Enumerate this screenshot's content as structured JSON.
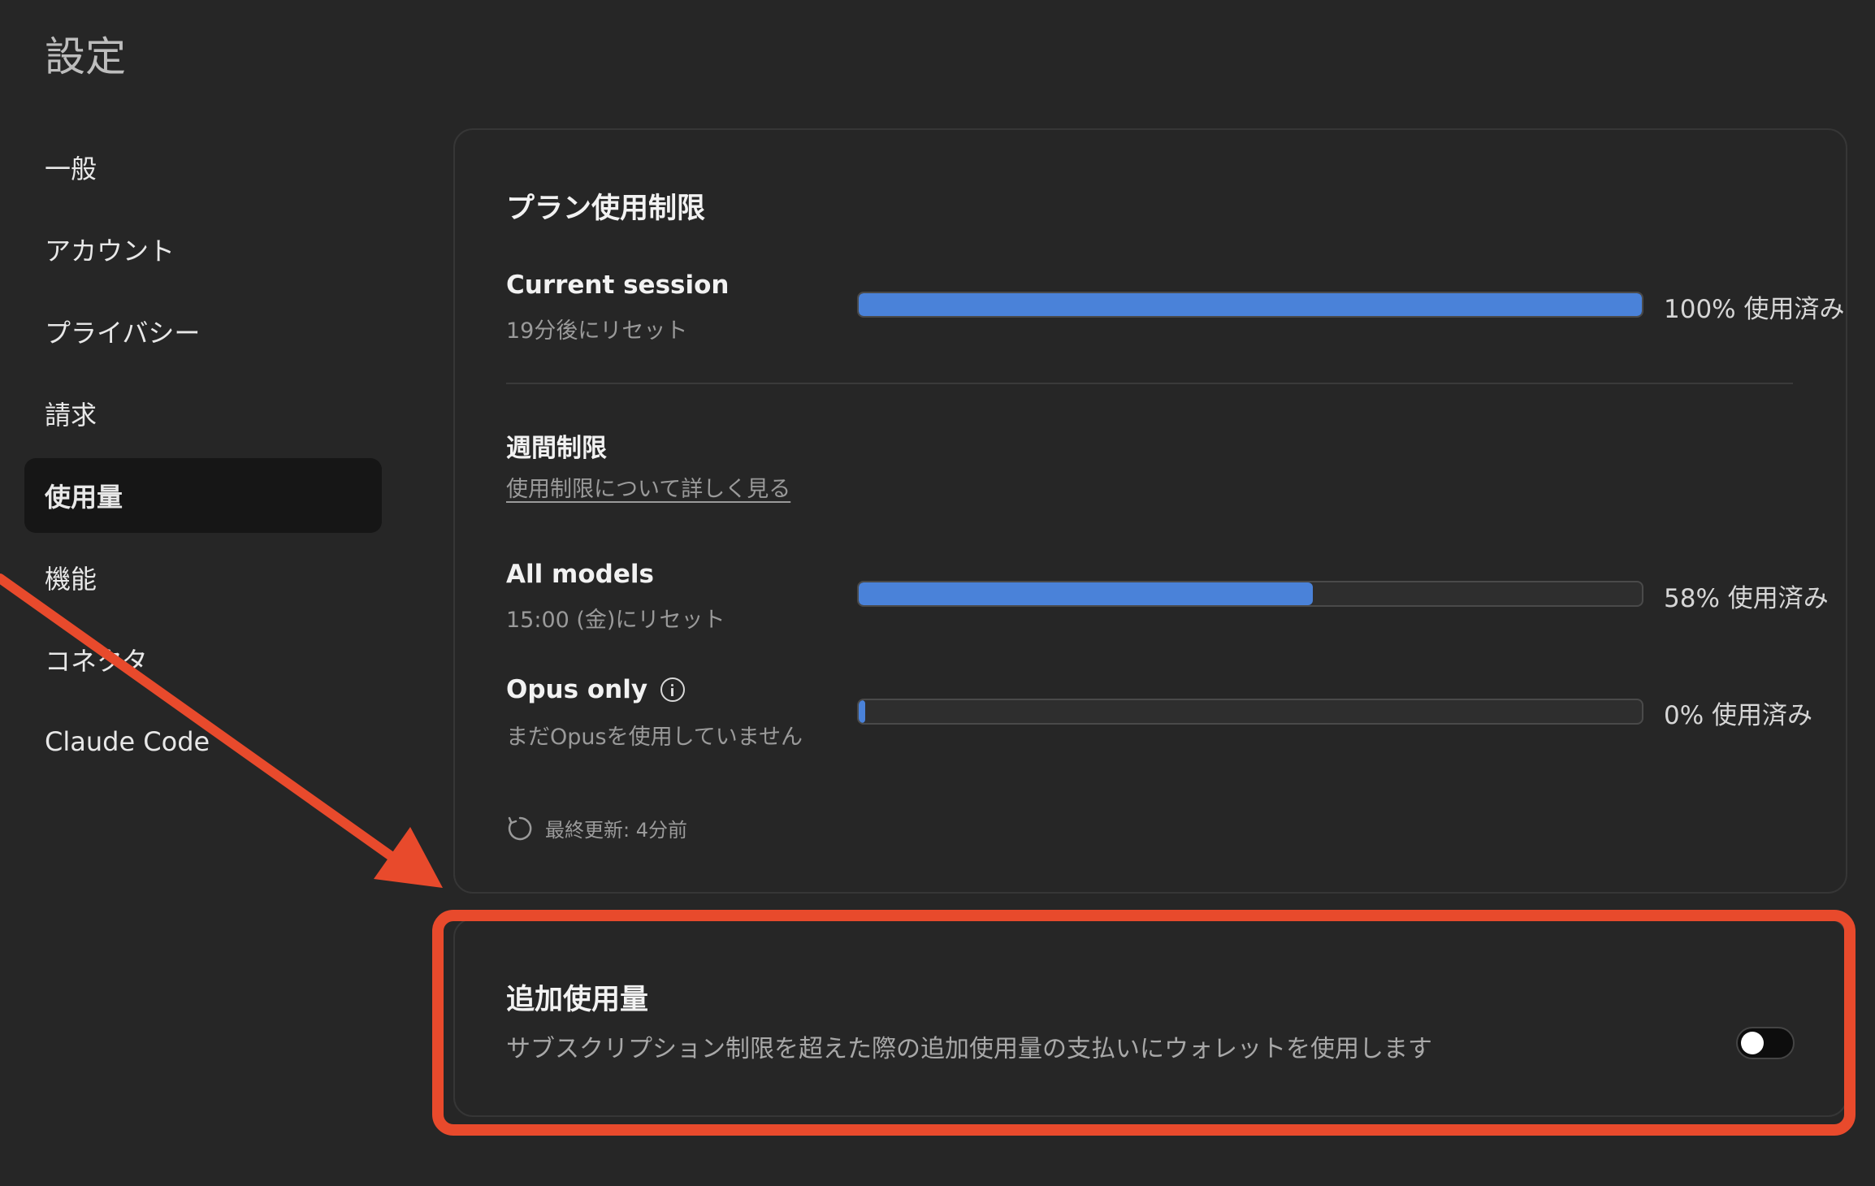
{
  "page": {
    "title": "設定"
  },
  "sidebar": {
    "items": [
      {
        "label": "一般"
      },
      {
        "label": "アカウント"
      },
      {
        "label": "プライバシー"
      },
      {
        "label": "請求"
      },
      {
        "label": "使用量",
        "active": true
      },
      {
        "label": "機能"
      },
      {
        "label": "コネクタ"
      },
      {
        "label": "Claude Code"
      }
    ]
  },
  "plan_limits": {
    "heading": "プラン使用制限",
    "current_session": {
      "label": "Current session",
      "reset": "19分後にリセット",
      "percent": 100,
      "usage_text": "100% 使用済み"
    },
    "weekly": {
      "heading": "週間制限",
      "link": "使用制限について詳しく見る"
    },
    "all_models": {
      "label": "All models",
      "reset": "15:00 (金)にリセット",
      "percent": 58,
      "usage_text": "58% 使用済み"
    },
    "opus_only": {
      "label": "Opus only",
      "note": "まだOpusを使用していません",
      "percent": 0,
      "usage_text": "0% 使用済み",
      "info_icon": "info-icon"
    },
    "last_updated": "最終更新: 4分前",
    "refresh_icon": "refresh-icon"
  },
  "extra_usage": {
    "heading": "追加使用量",
    "description": "サブスクリプション制限を超えた際の追加使用量の支払いにウォレットを使用します",
    "toggle_on": false
  },
  "colors": {
    "background": "#262626",
    "progress": "#4a82d9",
    "annotation": "#e84a2c"
  }
}
